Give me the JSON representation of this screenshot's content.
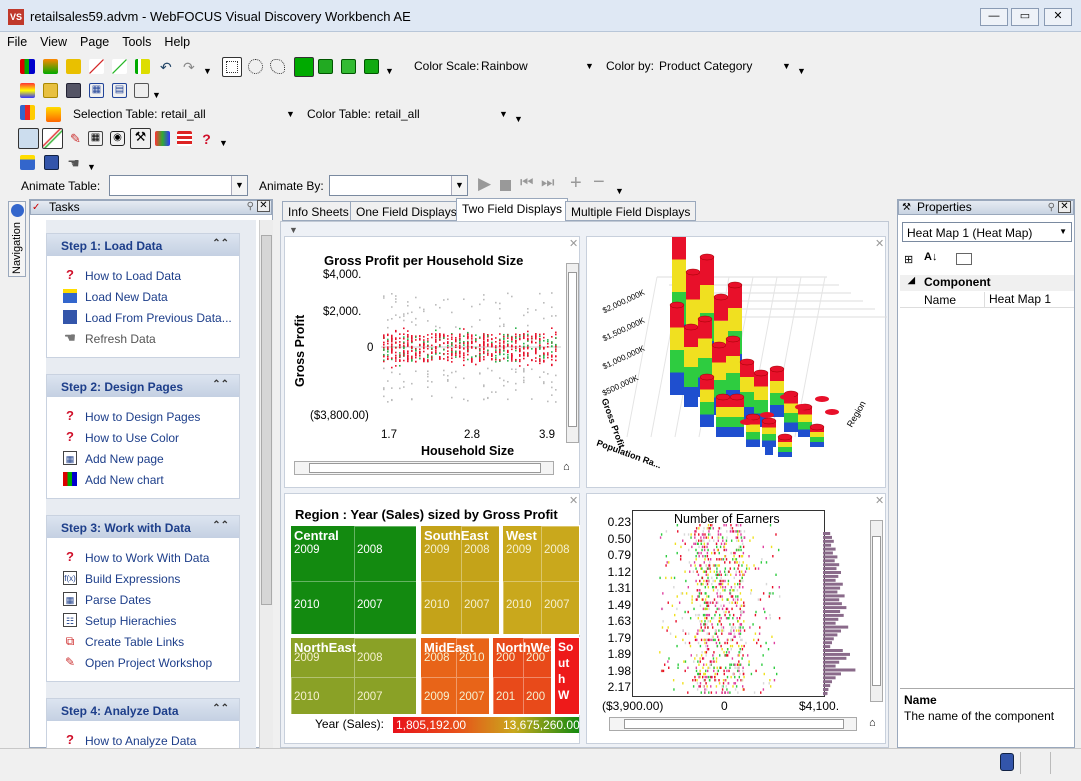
{
  "window": {
    "title": "retailsales59.advm - WebFOCUS Visual Discovery Workbench AE",
    "app_icon": "VS"
  },
  "menu": [
    "File",
    "View",
    "Page",
    "Tools",
    "Help"
  ],
  "toolbar": {
    "color_scale_label": "Color Scale:",
    "color_scale_value": "Rainbow",
    "color_by_label": "Color by:",
    "color_by_value": "Product Category",
    "selection_table_label": "Selection Table:",
    "selection_table_value": "retail_all",
    "color_table_label": "Color Table:",
    "color_table_value": "retail_all",
    "animate_table_label": "Animate Table:",
    "animate_table_value": "",
    "animate_by_label": "Animate By:",
    "animate_by_value": ""
  },
  "tasks": {
    "title": "Tasks",
    "nav_tab": "Navigation",
    "steps": [
      {
        "title": "Step 1:  Load Data",
        "items": [
          {
            "label": "How to Load Data",
            "icon": "help-icon"
          },
          {
            "label": "Load New Data",
            "icon": "load-data-icon"
          },
          {
            "label": "Load From Previous Data...",
            "icon": "previous-data-icon"
          },
          {
            "label": "Refresh Data",
            "icon": "refresh-icon",
            "disabled": true
          }
        ]
      },
      {
        "title": "Step 2:  Design Pages",
        "items": [
          {
            "label": "How to Design Pages",
            "icon": "help-icon"
          },
          {
            "label": "How to Use Color",
            "icon": "help-icon"
          },
          {
            "label": "Add New page",
            "icon": "new-page-icon"
          },
          {
            "label": "Add New chart",
            "icon": "new-chart-icon"
          }
        ]
      },
      {
        "title": "Step 3:  Work with Data",
        "items": [
          {
            "label": "How to Work With Data",
            "icon": "help-icon"
          },
          {
            "label": "Build Expressions",
            "icon": "expression-icon"
          },
          {
            "label": "Parse Dates",
            "icon": "calendar-icon"
          },
          {
            "label": "Setup Hierachies",
            "icon": "hierarchy-icon"
          },
          {
            "label": "Create Table Links",
            "icon": "link-icon"
          },
          {
            "label": "Open Project Workshop",
            "icon": "workshop-icon"
          }
        ]
      },
      {
        "title": "Step 4:  Analyze Data",
        "items": [
          {
            "label": "How to Analyze Data",
            "icon": "help-icon"
          }
        ]
      }
    ]
  },
  "tabs": [
    "Info Sheets",
    "One Field Displays",
    "Two Field Displays",
    "Multiple Field Displays"
  ],
  "active_tab": "Two Field Displays",
  "scatter": {
    "title": "Gross Profit per Household Size",
    "xlabel": "Household Size",
    "ylabel": "Gross Profit",
    "yticks": [
      "$4,000.",
      "$2,000.",
      "0",
      "($3,800.00)"
    ],
    "xticks": [
      "1.7",
      "2.8",
      "3.9"
    ]
  },
  "bar3d": {
    "axis_labels": [
      "$2,000,000K",
      "$1,500,000K",
      "$1,000,000K",
      "$500,000K"
    ],
    "ylabel": "Gross Profit",
    "xlabel": "Population Ra...",
    "zlabel": "Region"
  },
  "heatmap": {
    "title": "Region : Year (Sales) sized by Gross Profit",
    "legend_label": "Year (Sales):",
    "legend_min": "1,805,192.00",
    "legend_max": "13,675,260.00",
    "regions": [
      {
        "name": "Central",
        "color": "#138a10",
        "years": [
          "2009",
          "2008",
          "2010",
          "2007"
        ]
      },
      {
        "name": "SouthEast",
        "color": "#c4a319",
        "years": [
          "2009",
          "2008",
          "2010",
          "2007"
        ]
      },
      {
        "name": "West",
        "color": "#c9a81c",
        "years": [
          "2009",
          "2008",
          "2010",
          "2007"
        ]
      },
      {
        "name": "NorthEast",
        "color": "#8aa126",
        "years": [
          "2009",
          "2008",
          "2010",
          "2007"
        ]
      },
      {
        "name": "MidEast",
        "color": "#e86418",
        "years": [
          "2008",
          "2010",
          "2009",
          "2007"
        ]
      },
      {
        "name": "NorthWest",
        "color": "#e84a1a",
        "years": [
          "200",
          "200",
          "201",
          "200"
        ]
      },
      {
        "name": "South",
        "color": "#ee1a1a",
        "years": [
          "So",
          "ut",
          "h",
          "W"
        ]
      }
    ]
  },
  "strip": {
    "title": "Number of Earners",
    "yticks": [
      "0.23",
      "0.50",
      "0.79",
      "1.12",
      "1.31",
      "1.49",
      "1.63",
      "1.79",
      "1.89",
      "1.98",
      "2.17"
    ],
    "xticks": [
      "($3,900.00)",
      "0",
      "$4,100."
    ]
  },
  "properties": {
    "title": "Properties",
    "selected": "Heat Map 1 (Heat Map)",
    "category": "Component",
    "rows": [
      {
        "name": "Name",
        "value": "Heat Map 1"
      }
    ],
    "desc_title": "Name",
    "desc_text": "The name of the component"
  }
}
